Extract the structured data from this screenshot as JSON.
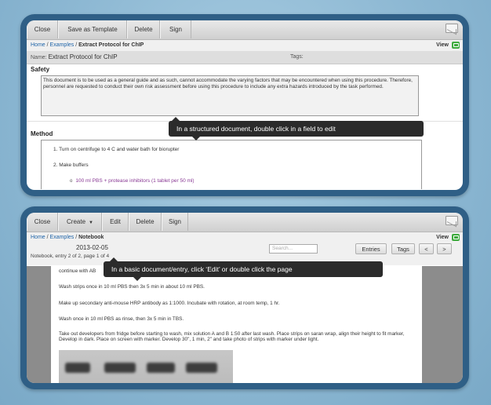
{
  "top_window": {
    "toolbar": {
      "buttons": [
        "Close",
        "Save as Template",
        "Delete",
        "Sign"
      ],
      "mail_icon": "mail-icon"
    },
    "breadcrumb": {
      "home": "Home",
      "sep": " / ",
      "examples": "Examples",
      "current": "Extract Protocol for ChIP"
    },
    "view_label": "View",
    "name_label": "Name:",
    "name_value": "Extract Protocol for ChIP",
    "tags_label": "Tags:",
    "safety_title": "Safety",
    "safety_text": "This document is to be used as a general guide and as such, cannot accommodate the varying factors that may be encountered when using this procedure. Therefore, personnel are requested to conduct their own risk assessment before using this procedure to include any extra hazards introduced by the task performed.",
    "method_title": "Method",
    "steps": [
      "1. Turn on centrifuge to 4 C and water bath for biorupter",
      "2. Make buffers"
    ],
    "substep": "100 ml PBS + protease inhibitors (1 tablet per 50 ml)",
    "tooltip": "In a structured document, double click in a field to edit"
  },
  "bottom_window": {
    "toolbar": {
      "buttons": [
        "Close",
        "Create",
        "Edit",
        "Delete",
        "Sign"
      ],
      "mail_icon": "mail-icon"
    },
    "breadcrumb": {
      "home": "Home",
      "sep": " / ",
      "examples": "Examples",
      "current": "Notebook"
    },
    "view_label": "View",
    "date": "2013-02-05",
    "entry_info": "Notebook, entry 2 of 2, page 1 of 4",
    "search_placeholder": "Search...",
    "pills": [
      "Entries",
      "Tags",
      "<",
      ">"
    ],
    "tooltip": "In a basic document/entry, click ‘Edit’ or double click the page",
    "paragraphs": [
      "continue with AB",
      "Wash strips once in 10 ml PBS then 3x 5 min in about 10 ml PBS.",
      "Make up secondary anti-mouse HRP antibody as 1:1000. Incubate with rotation, at room temp, 1 hr.",
      "Wash once in 10 ml PBS as rinse, then 3x 5 min in TBS.",
      "Take out developers from fridge before starting to wash, mix solution A and B 1:50 after last wash. Place strips on saran wrap, align their height to fit marker, Develop in dark. Place on screen with marker. Develop 30\", 1 min, 2\" and take photo of strips with marker under light."
    ]
  }
}
